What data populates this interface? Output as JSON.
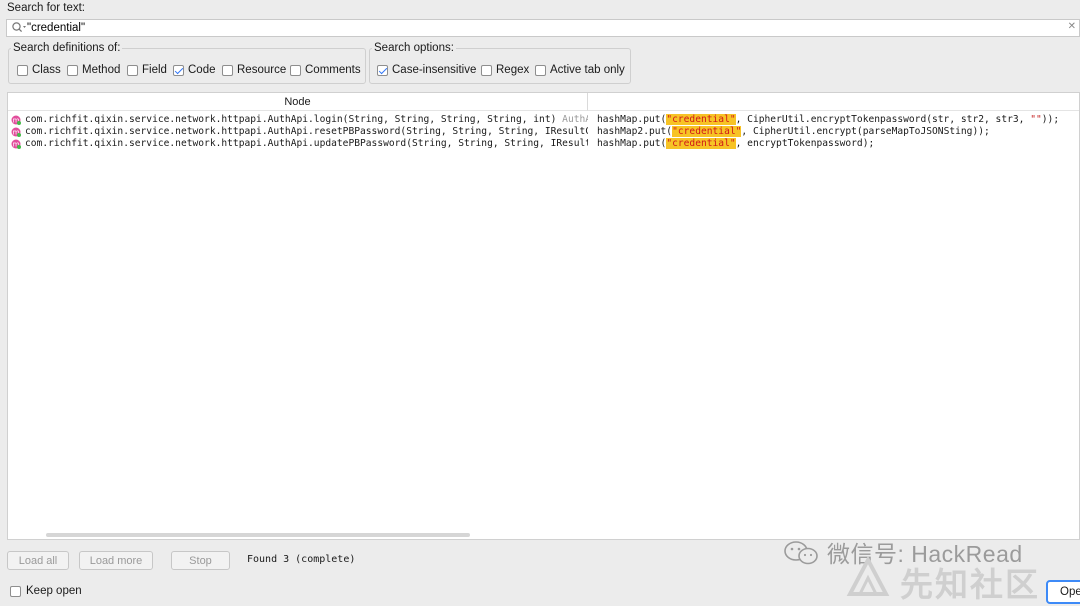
{
  "search": {
    "label": "Search for text:",
    "value": "\"credential\""
  },
  "definitions": {
    "title": "Search definitions of:",
    "options": [
      {
        "label": "Class",
        "checked": false
      },
      {
        "label": "Method",
        "checked": false
      },
      {
        "label": "Field",
        "checked": false
      },
      {
        "label": "Code",
        "checked": true
      },
      {
        "label": "Resource",
        "checked": false
      },
      {
        "label": "Comments",
        "checked": false
      }
    ]
  },
  "search_options": {
    "title": "Search options:",
    "options": [
      {
        "label": "Case-insensitive",
        "checked": true
      },
      {
        "label": "Regex",
        "checked": false
      },
      {
        "label": "Active tab only",
        "checked": false
      }
    ]
  },
  "results": {
    "column_node": "Node",
    "rows": [
      {
        "node": "com.richfit.qixin.service.network.httpapi.AuthApi.login(String, String, String, String, int)",
        "node_tail": " AuthApi",
        "code_pre": "hashMap.put(",
        "code_match": "\"credential\"",
        "code_post": ", CipherUtil.encryptTokenpassword(str, str2, str3, ",
        "code_str": "\"\"",
        "code_end": "));"
      },
      {
        "node": "com.richfit.qixin.service.network.httpapi.AuthApi.resetPBPassword(String, String, String, IResultCallback)",
        "node_tail": "",
        "code_pre": "hashMap2.put(",
        "code_match": "\"credential\"",
        "code_post": ", CipherUtil.encrypt(parseMapToJSONSting));",
        "code_str": "",
        "code_end": ""
      },
      {
        "node": "com.richfit.qixin.service.network.httpapi.AuthApi.updatePBPassword(String, String, String, IResultCallback)",
        "node_tail": "",
        "code_pre": "hashMap.put(",
        "code_match": "\"credential\"",
        "code_post": ", encryptTokenpassword);",
        "code_str": "",
        "code_end": ""
      }
    ]
  },
  "footer": {
    "load_all": "Load all",
    "load_more": "Load more",
    "stop": "Stop",
    "status": "Found 3 (complete)",
    "keep_open": "Keep open",
    "keep_open_checked": false,
    "open": "Open"
  },
  "watermark": {
    "line1": "微信号: HackRead",
    "line2": "先知社区"
  },
  "colors": {
    "highlight_bg": "#f7c325",
    "string_color": "#c41e1e",
    "accent": "#3478f6"
  }
}
